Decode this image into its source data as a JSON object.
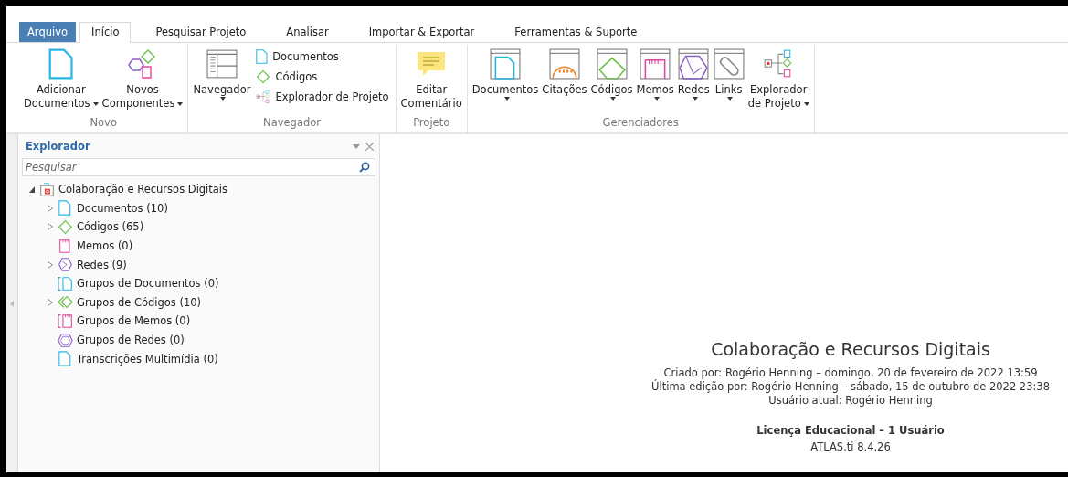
{
  "tabs": [
    {
      "label": "Arquivo",
      "kind": "file",
      "selected": false
    },
    {
      "label": "Início",
      "kind": "tab",
      "selected": true
    },
    {
      "label": "Pesquisar Projeto",
      "kind": "tab",
      "selected": false
    },
    {
      "label": "Analisar",
      "kind": "tab",
      "selected": false
    },
    {
      "label": "Importar & Exportar",
      "kind": "tab",
      "selected": false
    },
    {
      "label": "Ferramentas & Suporte",
      "kind": "tab",
      "selected": false
    }
  ],
  "ribbon": [
    {
      "title": "Novo",
      "items": [
        {
          "kind": "document",
          "lines": [
            "Adicionar",
            "Documentos"
          ],
          "dropdown": true
        },
        {
          "kind": "components",
          "lines": [
            "Novos",
            "Componentes"
          ],
          "dropdown": true
        }
      ]
    },
    {
      "title": "Navegador",
      "items": [
        {
          "kind": "navigator",
          "lines": [
            "Navegador"
          ],
          "dropdown": true
        },
        {
          "entries": [
            {
              "kind": "document",
              "label": "Documentos"
            },
            {
              "kind": "code",
              "label": "Códigos"
            },
            {
              "kind": "explorer",
              "label": "Explorador de Projeto"
            }
          ]
        }
      ]
    },
    {
      "title": "Projeto",
      "items": [
        {
          "kind": "comment",
          "lines": [
            "Editar",
            "Comentário"
          ],
          "dropdown": false
        }
      ]
    },
    {
      "title": "Gerenciadores",
      "items": [
        {
          "kind": "mgr-document",
          "lines": [
            "Documentos"
          ],
          "dropdown": true
        },
        {
          "kind": "mgr-quote",
          "lines": [
            "Citações"
          ],
          "dropdown": false
        },
        {
          "kind": "mgr-code",
          "lines": [
            "Códigos"
          ],
          "dropdown": true
        },
        {
          "kind": "mgr-memo",
          "lines": [
            "Memos"
          ],
          "dropdown": true
        },
        {
          "kind": "mgr-network",
          "lines": [
            "Redes"
          ],
          "dropdown": true
        },
        {
          "kind": "mgr-link",
          "lines": [
            "Links"
          ],
          "dropdown": true
        },
        {
          "kind": "explorer",
          "lines": [
            "Explorador",
            "de Projeto"
          ],
          "dropdown": true
        }
      ]
    }
  ],
  "explorer": {
    "title": "Explorador",
    "search": {
      "placeholder": "Pesquisar"
    },
    "tree": [
      {
        "label": "Colaboração e Recursos Digitais",
        "kind": "project",
        "expanded": true,
        "children": [
          {
            "label": "Documentos (10)",
            "kind": "document",
            "expanded": false,
            "expandable": true
          },
          {
            "label": "Códigos (65)",
            "kind": "code",
            "expanded": false,
            "expandable": true
          },
          {
            "label": "Memos (0)",
            "kind": "memo",
            "expandable": false
          },
          {
            "label": "Redes (9)",
            "kind": "network",
            "expanded": false,
            "expandable": true
          },
          {
            "label": "Grupos de Documentos (0)",
            "kind": "docgroup",
            "expandable": false
          },
          {
            "label": "Grupos de Códigos (10)",
            "kind": "codegroup",
            "expanded": false,
            "expandable": true
          },
          {
            "label": "Grupos de Memos (0)",
            "kind": "memogroup",
            "expandable": false
          },
          {
            "label": "Grupos de Redes (0)",
            "kind": "netgroup",
            "expandable": false
          },
          {
            "label": "Transcrições Multimídia (0)",
            "kind": "document",
            "expandable": false
          }
        ]
      }
    ]
  },
  "project_info": {
    "title": "Colaboração e Recursos Digitais",
    "details": [
      "Criado por: Rogério Henning – domingo, 20 de fevereiro de 2022 13:59",
      "Última edição por: Rogério Henning – sábado, 15 de outubro de 2022 23:38",
      "Usuário atual: Rogério Henning"
    ],
    "license": "Licença Educacional – 1 Usuário",
    "version": "ATLAS.ti 8.4.26"
  }
}
